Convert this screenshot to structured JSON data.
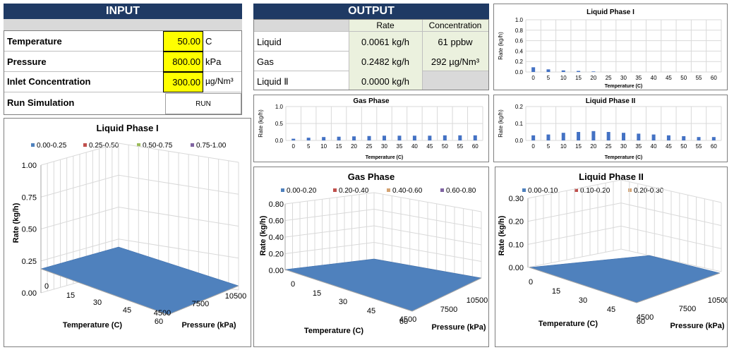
{
  "input": {
    "title": "INPUT",
    "rows": [
      {
        "label": "Temperature",
        "value": "50.00",
        "unit": "C"
      },
      {
        "label": "Pressure",
        "value": "800.00",
        "unit": "kPa"
      },
      {
        "label": "Inlet Concentration",
        "value": "300.00",
        "unit": "µg/Nm³"
      }
    ],
    "run_label": "Run Simulation",
    "run_button": "RUN"
  },
  "output": {
    "title": "OUTPUT",
    "headers": [
      "Rate",
      "Concentration"
    ],
    "rows": [
      {
        "label": "Liquid",
        "rate": "0.0061 kg/h",
        "conc": "61 ppbw"
      },
      {
        "label": "Gas",
        "rate": "0.2482 kg/h",
        "conc": "292 µg/Nm³"
      },
      {
        "label": "Liquid Ⅱ",
        "rate": "0.0000 kg/h",
        "conc": ""
      }
    ]
  },
  "chart_data": [
    {
      "type": "bar",
      "title": "Liquid Phase I",
      "xlabel": "Temperature (C)",
      "ylabel": "Rate (kg/h)",
      "categories": [
        "0",
        "5",
        "10",
        "15",
        "20",
        "25",
        "30",
        "35",
        "40",
        "45",
        "50",
        "55",
        "60"
      ],
      "values": [
        0.09,
        0.05,
        0.03,
        0.02,
        0.01,
        0,
        0,
        0,
        0,
        0,
        0,
        0,
        0
      ],
      "ylim": [
        0,
        1.0
      ],
      "yticks": [
        "0.0",
        "0.2",
        "0.4",
        "0.6",
        "0.8",
        "1.0"
      ],
      "color": "#4472c4",
      "grid": true
    },
    {
      "type": "bar",
      "title": "Gas Phase",
      "xlabel": "Temperature (C)",
      "ylabel": "Rate (kg/h)",
      "categories": [
        "0",
        "5",
        "10",
        "15",
        "20",
        "25",
        "30",
        "35",
        "40",
        "45",
        "50",
        "55",
        "60"
      ],
      "values": [
        0.05,
        0.08,
        0.1,
        0.11,
        0.12,
        0.13,
        0.14,
        0.14,
        0.14,
        0.14,
        0.15,
        0.15,
        0.15
      ],
      "ylim": [
        0,
        1.0
      ],
      "yticks": [
        "0.0",
        "0.5",
        "1.0"
      ],
      "color": "#4472c4",
      "grid": true
    },
    {
      "type": "bar",
      "title": "Liquid Phase II",
      "xlabel": "Temperature (C)",
      "ylabel": "Rate (kg/h)",
      "categories": [
        "0",
        "5",
        "10",
        "15",
        "20",
        "25",
        "30",
        "35",
        "40",
        "45",
        "50",
        "55",
        "60"
      ],
      "values": [
        0.03,
        0.035,
        0.045,
        0.05,
        0.055,
        0.05,
        0.045,
        0.04,
        0.035,
        0.03,
        0.025,
        0.02,
        0.02
      ],
      "ylim": [
        0,
        0.2
      ],
      "yticks": [
        "0.0",
        "0.1",
        "0.2"
      ],
      "color": "#4472c4",
      "grid": true
    },
    {
      "type": "surface",
      "title": "Liquid Phase I",
      "legend": [
        "0.00-0.25",
        "0.25-0.50",
        "0.50-0.75",
        "0.75-1.00"
      ],
      "legend_colors": [
        "#4f81bd",
        "#c0504d",
        "#9bbb59",
        "#8064a2"
      ],
      "zticks": [
        "0.00",
        "0.25",
        "0.50",
        "0.75",
        "1.00"
      ],
      "xticks": [
        "0",
        "15",
        "30",
        "45",
        "60"
      ],
      "yticks": [
        "4500",
        "7500",
        "10500"
      ],
      "xlabel": "Temperature (C)",
      "ylabel": "Pressure (kPa)",
      "zlabel": "Rate (kg/h)"
    },
    {
      "type": "surface",
      "title": "Gas Phase",
      "legend": [
        "0.00-0.20",
        "0.20-0.40",
        "0.40-0.60",
        "0.60-0.80"
      ],
      "legend_colors": [
        "#4f81bd",
        "#c0504d",
        "#d4a373",
        "#8064a2"
      ],
      "zticks": [
        "0.00",
        "0.20",
        "0.40",
        "0.60",
        "0.80"
      ],
      "xticks": [
        "0",
        "15",
        "30",
        "45",
        "60"
      ],
      "yticks": [
        "4500",
        "7500",
        "10500"
      ],
      "xlabel": "Temperature (C)",
      "ylabel": "Pressure (kPa)",
      "zlabel": "Rate (kg/h)"
    },
    {
      "type": "surface",
      "title": "Liquid Phase II",
      "legend": [
        "0.00-0.10",
        "0.10-0.20",
        "0.20-0.30"
      ],
      "legend_colors": [
        "#4f81bd",
        "#c0504d",
        "#d4a373"
      ],
      "zticks": [
        "0.00",
        "0.10",
        "0.20",
        "0.30"
      ],
      "xticks": [
        "0",
        "15",
        "30",
        "45",
        "60"
      ],
      "yticks": [
        "4500",
        "7500",
        "10500"
      ],
      "xlabel": "Temperature (C)",
      "ylabel": "Pressure (kPa)",
      "zlabel": "Rate (kg/h)"
    }
  ]
}
